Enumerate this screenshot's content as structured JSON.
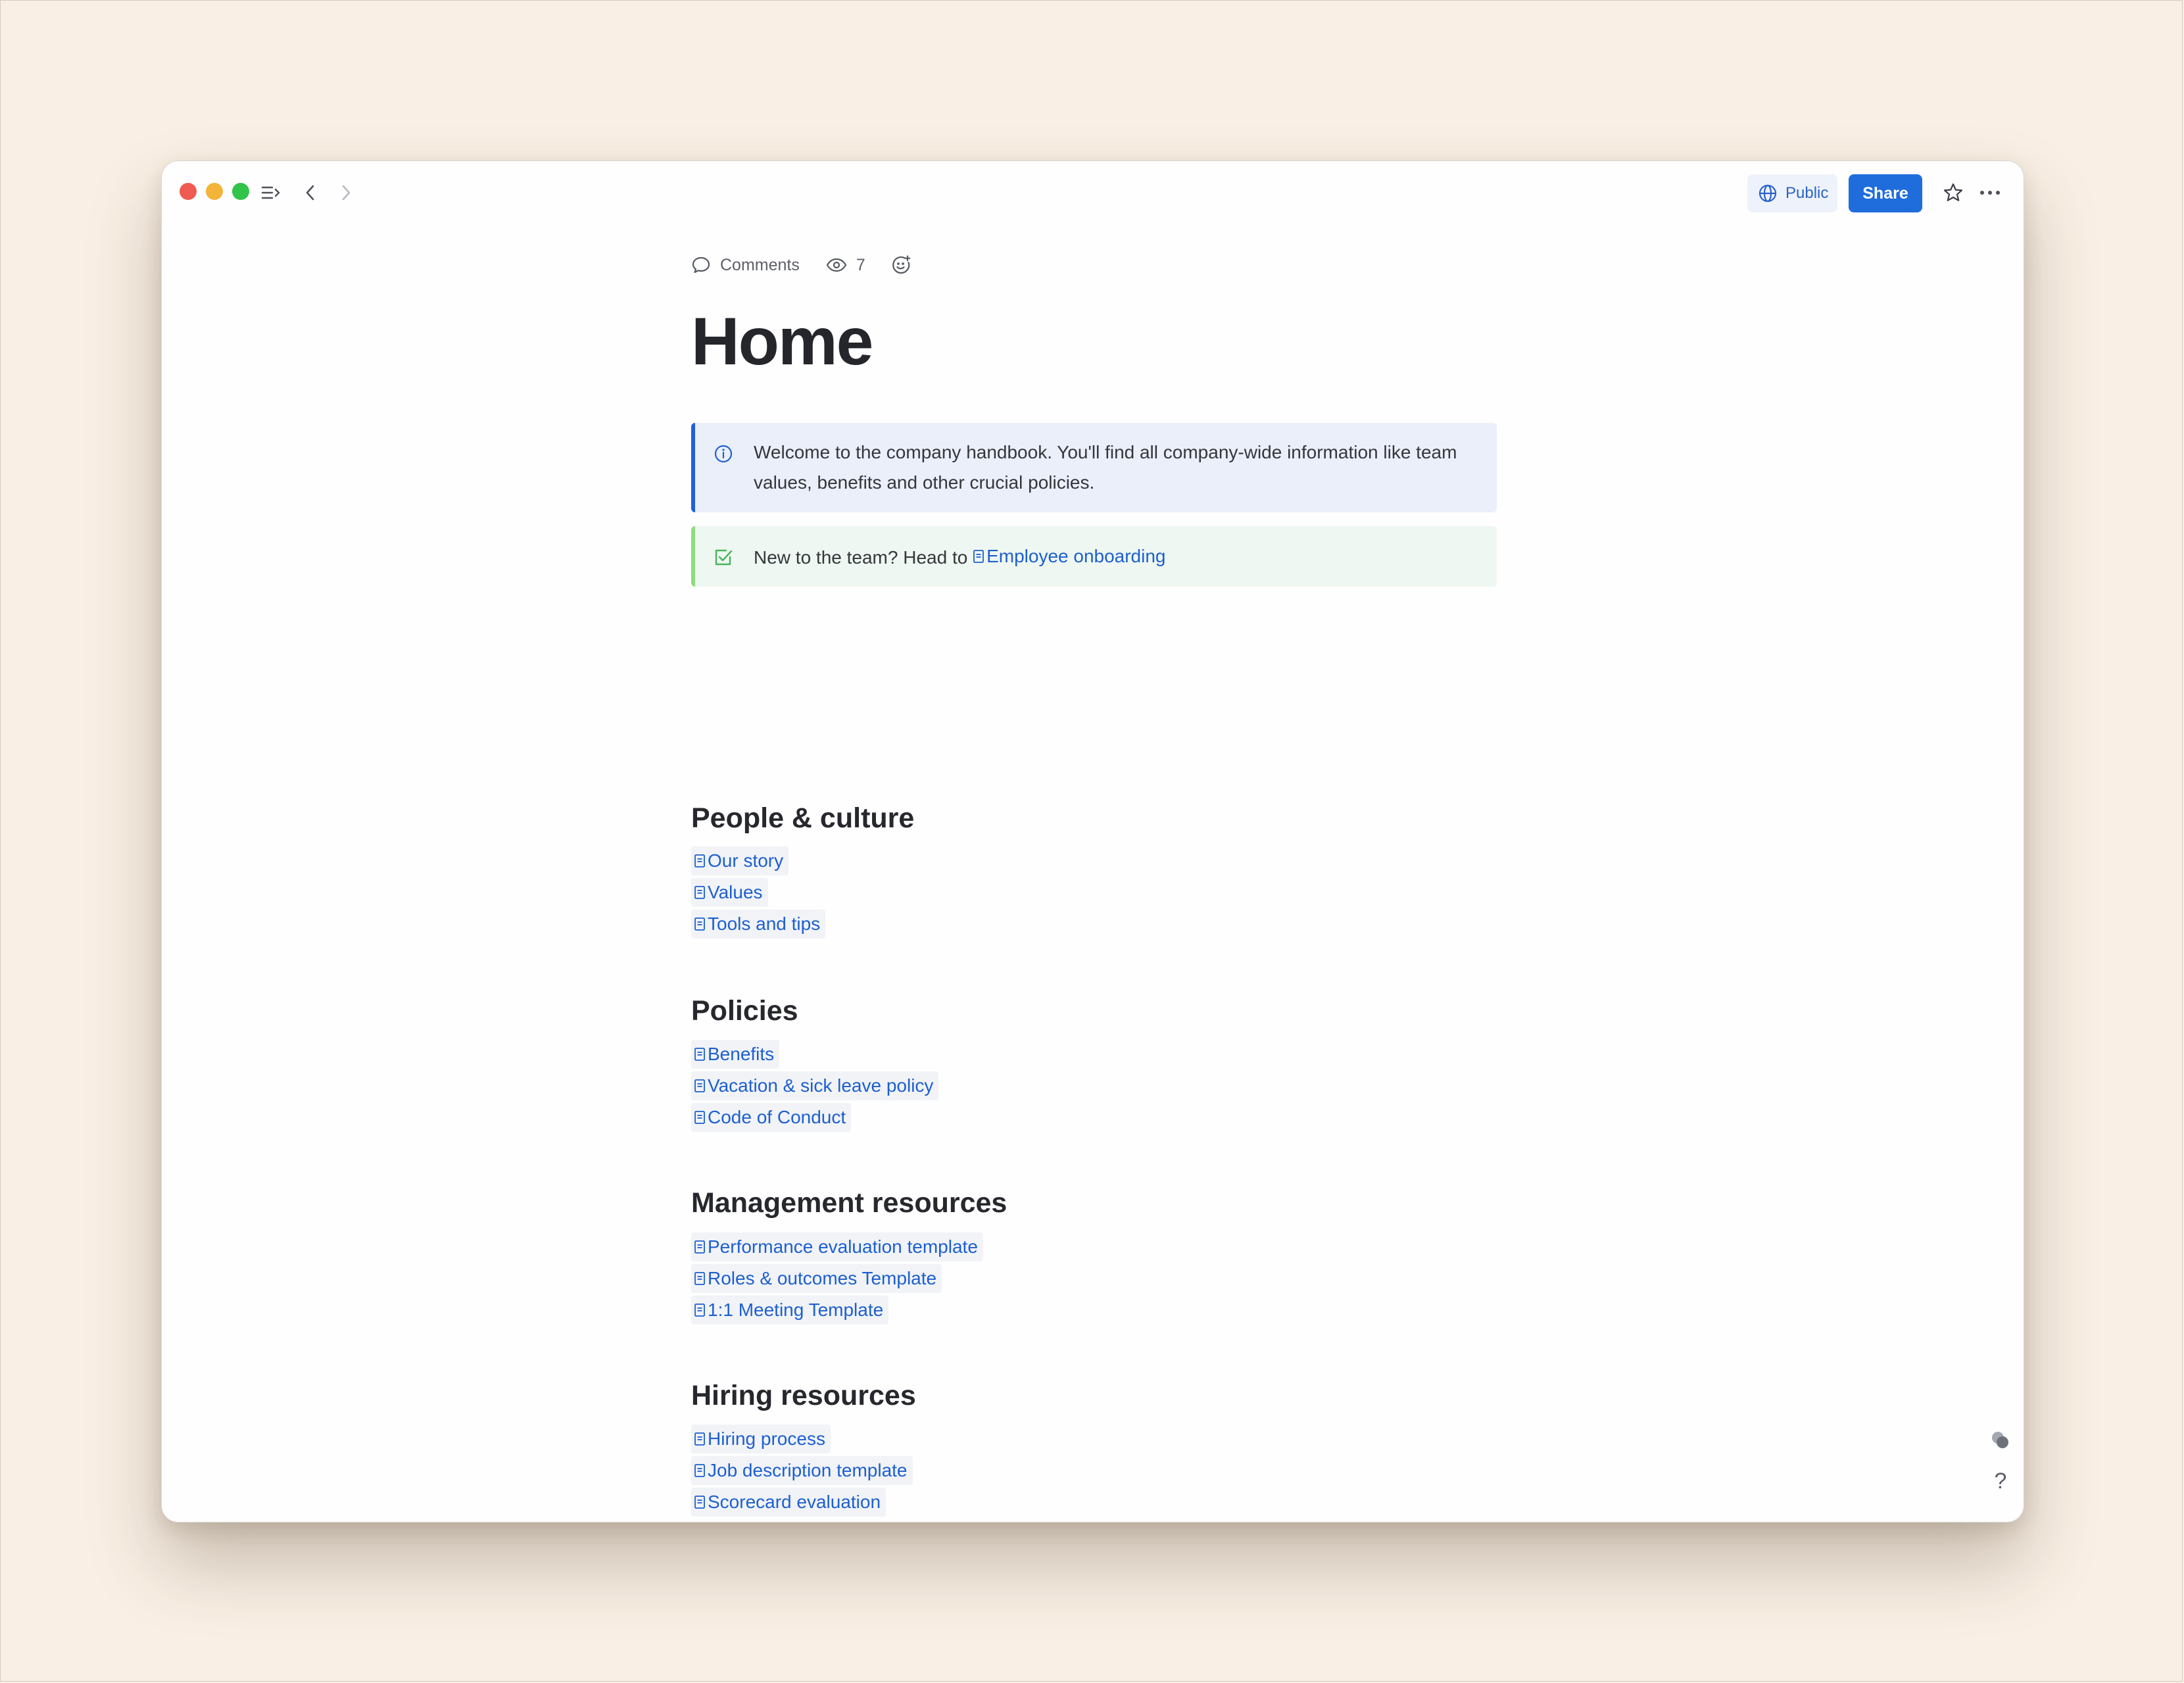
{
  "titlebar": {
    "public_label": "Public",
    "share_label": "Share"
  },
  "meta": {
    "comments_label": "Comments",
    "view_count": "7"
  },
  "page": {
    "title": "Home"
  },
  "callouts": {
    "info_text": "Welcome to the company handbook. You'll find all company-wide information like team values, benefits and other crucial policies.",
    "success_prefix": "New to the team? Head to ",
    "success_link": "Employee onboarding"
  },
  "sections": [
    {
      "heading": "People & culture",
      "links": [
        "Our story",
        "Values",
        "Tools and tips"
      ]
    },
    {
      "heading": "Policies",
      "links": [
        "Benefits",
        "Vacation & sick leave policy",
        "Code of Conduct"
      ]
    },
    {
      "heading": "Management resources",
      "links": [
        "Performance evaluation template",
        "Roles & outcomes Template",
        "1:1 Meeting Template"
      ]
    },
    {
      "heading": "Hiring resources",
      "links": [
        "Hiring process",
        "Job description template",
        "Scorecard evaluation"
      ]
    }
  ],
  "help": {
    "label": "?"
  },
  "colors": {
    "background": "#f9efe4",
    "accent": "#1f6ddc",
    "link": "#1d5fcf",
    "info_border": "#2060d4",
    "success_border": "#8fdc7f"
  },
  "icons": [
    "sidebar-toggle-icon",
    "back-arrow-icon",
    "forward-arrow-icon",
    "globe-icon",
    "star-icon",
    "more-icon",
    "comment-icon",
    "eye-icon",
    "emoji-add-icon",
    "info-icon",
    "checkbox-icon",
    "document-icon",
    "presence-icon"
  ]
}
